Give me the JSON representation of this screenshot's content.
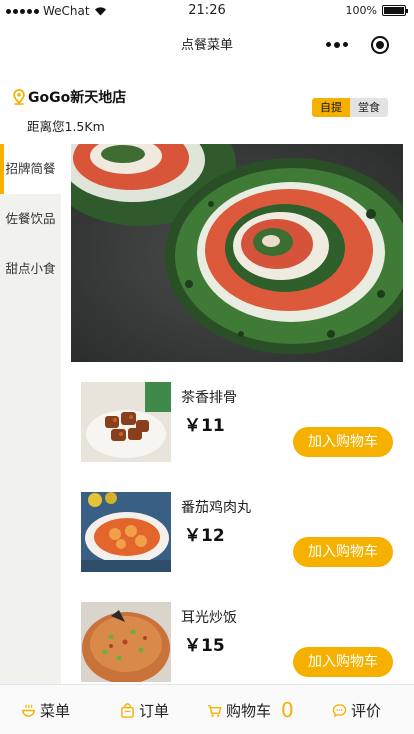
{
  "status_bar": {
    "carrier": "WeChat",
    "time": "21:26",
    "battery": "100%"
  },
  "navbar": {
    "title": "点餐菜单",
    "more_icon": "more-dots-icon",
    "target_icon": "target-icon"
  },
  "store": {
    "name": "GoGo新天地店",
    "distance": "距离您1.5Km",
    "modes": [
      "自提",
      "堂食"
    ],
    "active_mode": "自提"
  },
  "categories": [
    "招牌简餐",
    "佐餐饮品",
    "甜点小食"
  ],
  "active_category": "招牌简餐",
  "products": [
    {
      "name": "茶香排骨",
      "price": "￥11",
      "button": "加入购物车"
    },
    {
      "name": "番茄鸡肉丸",
      "price": "￥12",
      "button": "加入购物车"
    },
    {
      "name": "耳光炒饭",
      "price": "￥15",
      "button": "加入购物车"
    }
  ],
  "tabbar": {
    "menu": "菜单",
    "orders": "订单",
    "cart": "购物车",
    "cart_count": "0",
    "review": "评价"
  },
  "colors": {
    "accent": "#f6b100",
    "sidebar_bg": "#f1f1ee"
  }
}
